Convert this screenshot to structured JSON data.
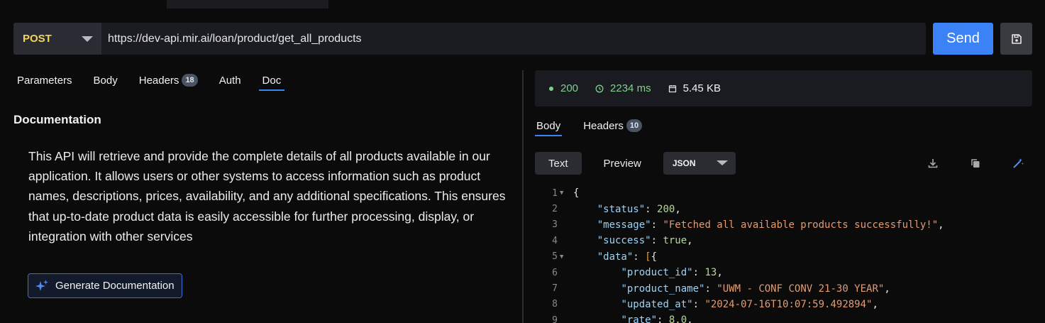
{
  "request": {
    "method": "POST",
    "url": "https://dev-api.mir.ai/loan/product/get_all_products",
    "send_label": "Send",
    "tabs": [
      {
        "label": "Parameters"
      },
      {
        "label": "Body"
      },
      {
        "label": "Headers",
        "badge": "18"
      },
      {
        "label": "Auth"
      },
      {
        "label": "Doc",
        "active": true
      }
    ]
  },
  "documentation": {
    "heading": "Documentation",
    "body": "This API will retrieve and provide the complete details of all products available in our application. It allows users or other systems to access information such as product names, descriptions, prices, availability, and any additional specifications. This ensures that up-to-date product data is easily accessible for further processing, display, or integration with other services",
    "generate_label": "Generate Documentation"
  },
  "response": {
    "status_code": "200",
    "time": "2234 ms",
    "size": "5.45 KB",
    "tabs": [
      {
        "label": "Body",
        "active": true
      },
      {
        "label": "Headers",
        "badge": "10"
      }
    ],
    "view_modes": [
      {
        "label": "Text",
        "active": true
      },
      {
        "label": "Preview"
      }
    ],
    "format": "JSON",
    "icons": [
      "download-icon",
      "copy-icon",
      "magic-wand-icon"
    ],
    "code_lines": [
      {
        "n": "1",
        "fold": true,
        "parts": [
          [
            "txt",
            "{"
          ]
        ]
      },
      {
        "n": "2",
        "parts": [
          [
            "txt",
            "    "
          ],
          [
            "k",
            "\"status\""
          ],
          [
            "txt",
            ": "
          ],
          [
            "n",
            "200"
          ],
          [
            "txt",
            ","
          ]
        ]
      },
      {
        "n": "3",
        "parts": [
          [
            "txt",
            "    "
          ],
          [
            "k",
            "\"message\""
          ],
          [
            "txt",
            ": "
          ],
          [
            "s",
            "\"Fetched all available products successfully!\""
          ],
          [
            "txt",
            ","
          ]
        ]
      },
      {
        "n": "4",
        "parts": [
          [
            "txt",
            "    "
          ],
          [
            "k",
            "\"success\""
          ],
          [
            "txt",
            ": "
          ],
          [
            "b",
            "true"
          ],
          [
            "txt",
            ","
          ]
        ]
      },
      {
        "n": "5",
        "fold": true,
        "parts": [
          [
            "txt",
            "    "
          ],
          [
            "k",
            "\"data\""
          ],
          [
            "txt",
            ": "
          ],
          [
            "br",
            "["
          ],
          [
            "txt",
            "{"
          ]
        ]
      },
      {
        "n": "6",
        "parts": [
          [
            "txt",
            "        "
          ],
          [
            "k",
            "\"product_id\""
          ],
          [
            "txt",
            ": "
          ],
          [
            "n",
            "13"
          ],
          [
            "txt",
            ","
          ]
        ]
      },
      {
        "n": "7",
        "parts": [
          [
            "txt",
            "        "
          ],
          [
            "k",
            "\"product_name\""
          ],
          [
            "txt",
            ": "
          ],
          [
            "s",
            "\"UWM - CONF CONV 21-30 YEAR\""
          ],
          [
            "txt",
            ","
          ]
        ]
      },
      {
        "n": "8",
        "parts": [
          [
            "txt",
            "        "
          ],
          [
            "k",
            "\"updated_at\""
          ],
          [
            "txt",
            ": "
          ],
          [
            "s",
            "\"2024-07-16T10:07:59.492894\""
          ],
          [
            "txt",
            ","
          ]
        ]
      },
      {
        "n": "9",
        "parts": [
          [
            "txt",
            "        "
          ],
          [
            "k",
            "\"rate\""
          ],
          [
            "txt",
            ": "
          ],
          [
            "n",
            "8.0"
          ],
          [
            "txt",
            ","
          ]
        ]
      }
    ]
  },
  "colors": {
    "accent": "#3b82f6",
    "method": "#f3d55b",
    "success": "#7fd08d",
    "json_key": "#9fd3f5",
    "json_string": "#e49b72",
    "json_number": "#b5d99a"
  }
}
